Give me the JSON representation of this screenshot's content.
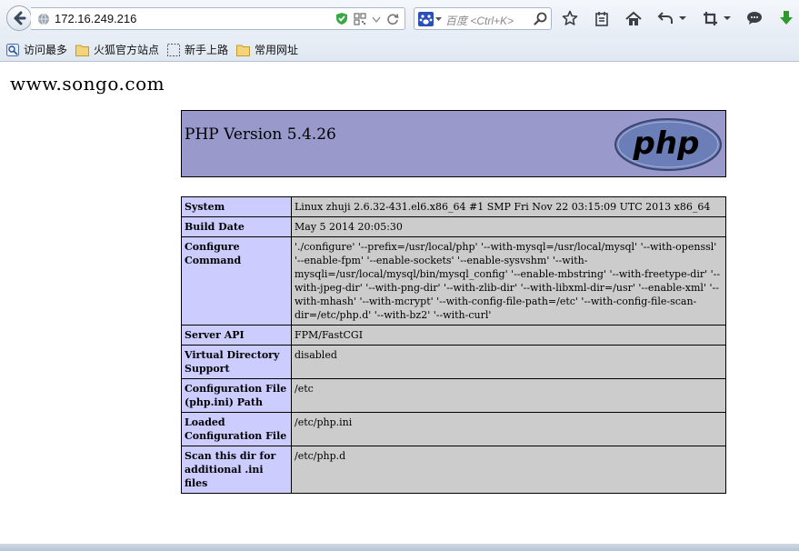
{
  "browser": {
    "url": "172.16.249.216",
    "search_placeholder": "百度 <Ctrl+K>"
  },
  "bookmarks": [
    {
      "label": "访问最多",
      "icon": "most-visited-icon"
    },
    {
      "label": "火狐官方站点",
      "icon": "folder-icon"
    },
    {
      "label": "新手上路",
      "icon": "dotted-page-icon"
    },
    {
      "label": "常用网址",
      "icon": "folder-icon"
    }
  ],
  "page": {
    "site_title": "www.songo.com",
    "php_version": "PHP Version 5.4.26",
    "logo_text": "php",
    "rows": [
      {
        "key": "System",
        "value": "Linux zhuji 2.6.32-431.el6.x86_64 #1 SMP Fri Nov 22 03:15:09 UTC 2013 x86_64"
      },
      {
        "key": "Build Date",
        "value": "May 5 2014 20:05:30"
      },
      {
        "key": "Configure Command",
        "value": "'./configure' '--prefix=/usr/local/php' '--with-mysql=/usr/local/mysql' '--with-openssl' '--enable-fpm' '--enable-sockets' '--enable-sysvshm' '--with-mysqli=/usr/local/mysql/bin/mysql_config' '--enable-mbstring' '--with-freetype-dir' '--with-jpeg-dir' '--with-png-dir' '--with-zlib-dir' '--with-libxml-dir=/usr' '--enable-xml' '--with-mhash' '--with-mcrypt' '--with-config-file-path=/etc' '--with-config-file-scan-dir=/etc/php.d' '--with-bz2' '--with-curl'"
      },
      {
        "key": "Server API",
        "value": "FPM/FastCGI"
      },
      {
        "key": "Virtual Directory Support",
        "value": "disabled"
      },
      {
        "key": "Configuration File (php.ini) Path",
        "value": "/etc"
      },
      {
        "key": "Loaded Configuration File",
        "value": "/etc/php.ini"
      },
      {
        "key": "Scan this dir for additional .ini files",
        "value": "/etc/php.d"
      }
    ]
  }
}
